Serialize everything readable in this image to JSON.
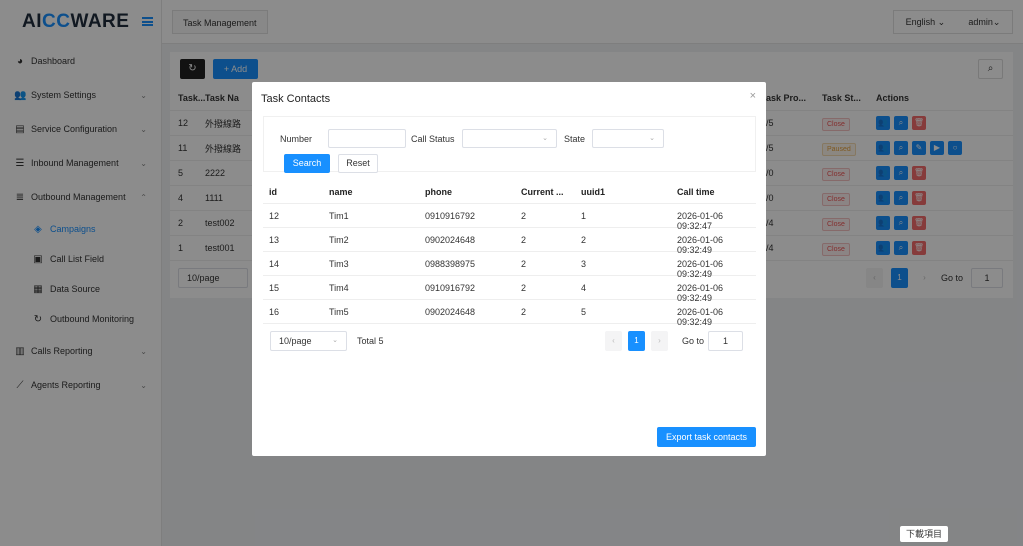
{
  "sidebar": {
    "logo_a": "AI",
    "logo_b": "CC",
    "logo_c": "WARE",
    "items": [
      {
        "label": "Dashboard",
        "icon": "dashboard-icon",
        "glyph": "◕",
        "chev": ""
      },
      {
        "label": "System Settings",
        "icon": "users-icon",
        "glyph": "👥",
        "chev": "⌄"
      },
      {
        "label": "Service Configuration",
        "icon": "id-card-icon",
        "glyph": "▤",
        "chev": "⌄"
      },
      {
        "label": "Inbound Management",
        "icon": "inbox-icon",
        "glyph": "☰",
        "chev": "⌄"
      },
      {
        "label": "Outbound Management",
        "icon": "list-icon",
        "glyph": "≣",
        "chev": "⌃"
      }
    ],
    "sub_items": [
      {
        "label": "Campaigns",
        "icon": "campaign-icon",
        "glyph": "◈"
      },
      {
        "label": "Call List Field",
        "icon": "field-icon",
        "glyph": "▣"
      },
      {
        "label": "Data Source",
        "icon": "grid-icon",
        "glyph": "▦"
      },
      {
        "label": "Outbound Monitoring",
        "icon": "monitor-icon",
        "glyph": "↻"
      }
    ],
    "items2": [
      {
        "label": "Calls Reporting",
        "icon": "bar-chart-icon",
        "glyph": "▥",
        "chev": "⌄"
      },
      {
        "label": "Agents Reporting",
        "icon": "line-chart-icon",
        "glyph": "⟋",
        "chev": "⌄"
      }
    ]
  },
  "topbar": {
    "tab": "Task Management",
    "language": "English",
    "user": "admin"
  },
  "background": {
    "add_label": "Add",
    "headers": [
      "Task...",
      "Task Na",
      "ask Pro...",
      "Task St...",
      "Actions"
    ],
    "rows": [
      {
        "id": "12",
        "name": "外撥線路",
        "pro": "/5",
        "status": "Close",
        "paused": false
      },
      {
        "id": "11",
        "name": "外撥線路",
        "pro": "/5",
        "status": "Paused",
        "paused": true
      },
      {
        "id": "5",
        "name": "2222",
        "pro": "/0",
        "status": "Close",
        "paused": false
      },
      {
        "id": "4",
        "name": "1111",
        "pro": "/0",
        "status": "Close",
        "paused": false
      },
      {
        "id": "2",
        "name": "test002",
        "pro": "/4",
        "status": "Close",
        "paused": false
      },
      {
        "id": "1",
        "name": "test001",
        "pro": "/4",
        "status": "Close",
        "paused": false
      }
    ],
    "page_size": "10/page",
    "page": "1",
    "goto_label": "Go to",
    "goto_value": "1"
  },
  "modal": {
    "title": "Task Contacts",
    "close": "×",
    "filters": {
      "number_label": "Number",
      "number_value": "",
      "call_status_label": "Call Status",
      "state_label": "State",
      "search_label": "Search",
      "reset_label": "Reset"
    },
    "columns": [
      "id",
      "name",
      "phone",
      "Current ...",
      "uuid1",
      "Call time"
    ],
    "rows": [
      {
        "id": "12",
        "name": "Tim1",
        "phone": "0910916792",
        "current": "2",
        "uuid1": "1",
        "time": "2026-01-06 09:32:47"
      },
      {
        "id": "13",
        "name": "Tim2",
        "phone": "0902024648",
        "current": "2",
        "uuid1": "2",
        "time": "2026-01-06 09:32:49"
      },
      {
        "id": "14",
        "name": "Tim3",
        "phone": "0988398975",
        "current": "2",
        "uuid1": "3",
        "time": "2026-01-06 09:32:49"
      },
      {
        "id": "15",
        "name": "Tim4",
        "phone": "0910916792",
        "current": "2",
        "uuid1": "4",
        "time": "2026-01-06 09:32:49"
      },
      {
        "id": "16",
        "name": "Tim5",
        "phone": "0902024648",
        "current": "2",
        "uuid1": "5",
        "time": "2026-01-06 09:32:49"
      }
    ],
    "pager": {
      "page_size": "10/page",
      "total": "Total 5",
      "prev": "‹",
      "page": "1",
      "next": "›",
      "goto_label": "Go to",
      "goto_value": "1"
    },
    "export_label": "Export task contacts"
  },
  "download_tip": "下載項目"
}
